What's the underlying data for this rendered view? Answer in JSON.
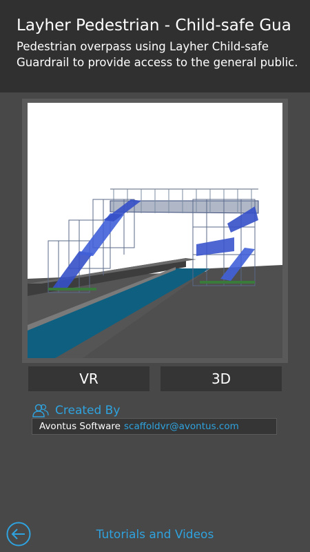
{
  "header": {
    "title": "Layher Pedestrian - Child-safe Gua",
    "subtitle": "Pedestrian overpass using Layher Child-safe Guardrail to provide access to the general public."
  },
  "buttons": {
    "vr": "VR",
    "three_d": "3D"
  },
  "created_by": {
    "label": "Created By",
    "icon": "users-icon",
    "author": "Avontus Software",
    "email": "scaffoldvr@avontus.com"
  },
  "footer": {
    "back_icon": "back-arrow-icon",
    "tutorials": "Tutorials and Videos"
  },
  "colors": {
    "background": "#484848",
    "header": "#303030",
    "button": "#353535",
    "accent": "#2fa3df"
  }
}
